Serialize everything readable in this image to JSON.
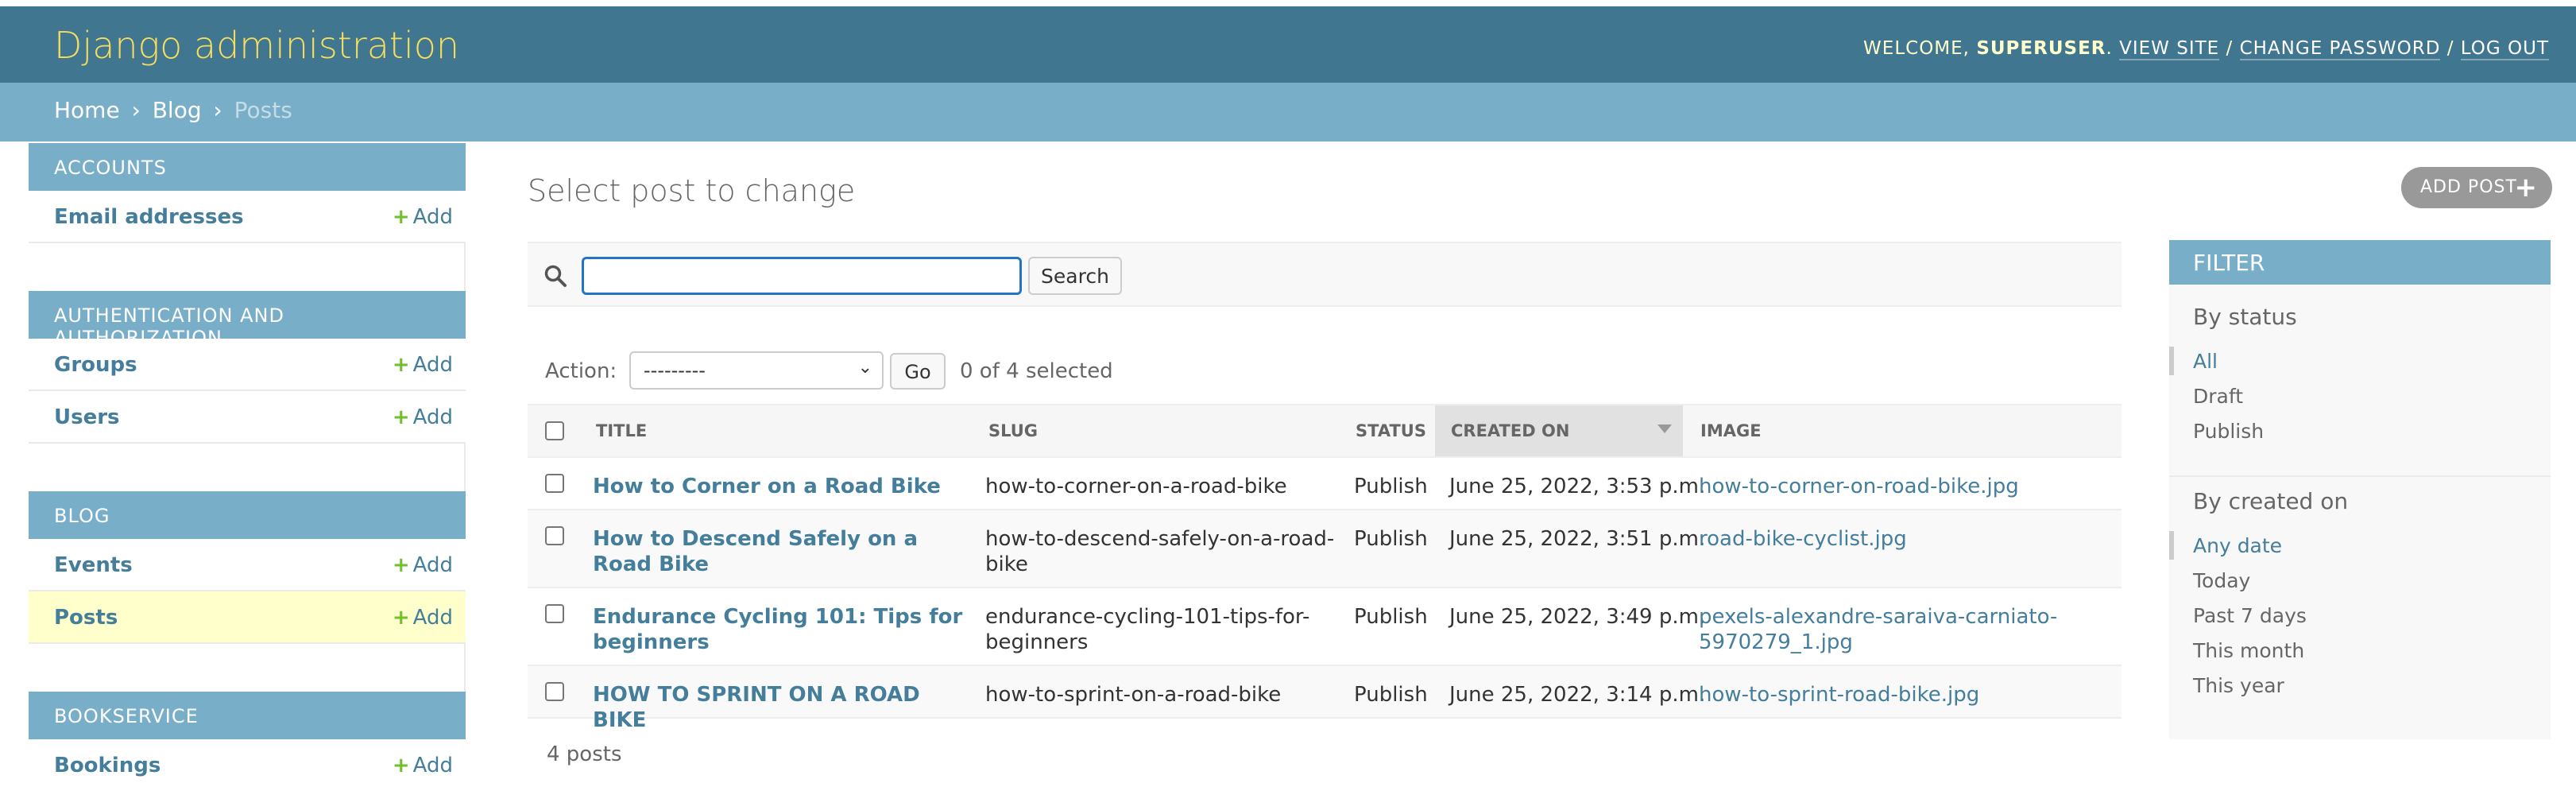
{
  "header": {
    "branding": "Django administration",
    "welcome": "Welcome,",
    "username": "superuser",
    "view_site": "View site",
    "change_password": "Change password",
    "log_out": "Log out",
    "sep": "/"
  },
  "breadcrumbs": {
    "home": "Home",
    "app": "Blog",
    "current": "Posts",
    "sep": "›"
  },
  "sidebar": {
    "add_label": "Add",
    "apps": [
      {
        "caption": "Accounts",
        "models": [
          {
            "name": "Email addresses"
          }
        ]
      },
      {
        "caption": "Authentication and Authorization",
        "models": [
          {
            "name": "Groups"
          },
          {
            "name": "Users"
          }
        ]
      },
      {
        "caption": "Blog",
        "models": [
          {
            "name": "Events"
          },
          {
            "name": "Posts"
          }
        ]
      },
      {
        "caption": "Bookservice",
        "models": [
          {
            "name": "Bookings"
          }
        ]
      }
    ]
  },
  "content": {
    "title": "Select post to change",
    "add_button": "Add post"
  },
  "search": {
    "value": "",
    "placeholder": "",
    "button": "Search"
  },
  "actions": {
    "label": "Action:",
    "selected_option": "---------",
    "go": "Go",
    "counter": "0 of 4 selected"
  },
  "table": {
    "columns": [
      "Title",
      "Slug",
      "Status",
      "Created on",
      "Image"
    ],
    "sorted_column": "Created on",
    "rows": [
      {
        "title": "How to Corner on a Road Bike",
        "slug": [
          "how-to-corner-on-a-road-bike"
        ],
        "status": "Publish",
        "created": "June 25, 2022, 3:53 p.m.",
        "image": [
          "how-to-corner-on-road-bike.jpg"
        ]
      },
      {
        "title": [
          "How to Descend Safely on a Road Bike"
        ],
        "slug": [
          "how-to-descend-safely-on-a-road-",
          "bike"
        ],
        "status": "Publish",
        "created": "June 25, 2022, 3:51 p.m.",
        "image": [
          "road-bike-cyclist.jpg"
        ]
      },
      {
        "title": [
          "Endurance Cycling 101: Tips for",
          "beginners"
        ],
        "slug": [
          "endurance-cycling-101-tips-for-",
          "beginners"
        ],
        "status": "Publish",
        "created": "June 25, 2022, 3:49 p.m.",
        "image": [
          "pexels-alexandre-saraiva-carniato-",
          "5970279_1.jpg"
        ]
      },
      {
        "title": [
          "HOW TO SPRINT ON A ROAD BIKE"
        ],
        "slug": [
          "how-to-sprint-on-a-road-bike"
        ],
        "status": "Publish",
        "created": "June 25, 2022, 3:14 p.m.",
        "image": [
          "how-to-sprint-road-bike.jpg"
        ]
      }
    ]
  },
  "paginator": "4 posts",
  "filter": {
    "title": "Filter",
    "groups": [
      {
        "heading": "By status",
        "items": [
          "All",
          "Draft",
          "Publish"
        ],
        "selected": "All"
      },
      {
        "heading": "By created on",
        "items": [
          "Any date",
          "Today",
          "Past 7 days",
          "This month",
          "This year"
        ],
        "selected": "Any date"
      }
    ]
  },
  "colors": {
    "header": "#417690",
    "branding": "#f5dd5d",
    "module_caption": "#79aec8",
    "link": "#447e9b",
    "add_plus": "#70bf2b",
    "current_row": "#ffffcc"
  }
}
